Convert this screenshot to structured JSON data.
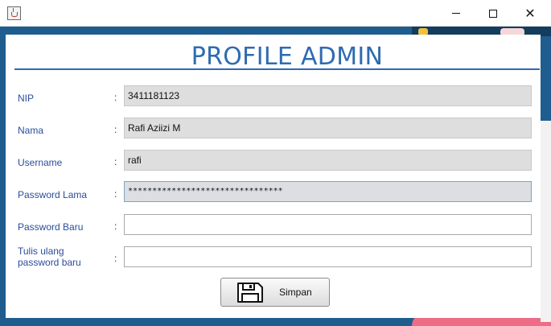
{
  "window": {
    "icon": "java-cup-icon",
    "controls": {
      "minimize": "minimize-icon",
      "maximize": "maximize-icon",
      "close": "close-icon"
    },
    "close_glyph": "✕"
  },
  "page": {
    "title": "PROFILE ADMIN"
  },
  "form": {
    "colon": ":",
    "fields": [
      {
        "label": "NIP",
        "value": "3411181123"
      },
      {
        "label": "Nama",
        "value": "Rafi Aziizi M"
      },
      {
        "label": "Username",
        "value": "rafi"
      },
      {
        "label": "Password Lama",
        "value": "********************************"
      },
      {
        "label": "Password Baru",
        "value": ""
      },
      {
        "label_line1": "Tulis ulang",
        "label_line2": "password baru",
        "value": ""
      }
    ]
  },
  "actions": {
    "save_label": "Simpan",
    "save_icon": "floppy-disk-icon"
  },
  "colors": {
    "accent": "#2f6bb1",
    "label": "#2a4d9b",
    "readonly_bg": "#dedede"
  }
}
